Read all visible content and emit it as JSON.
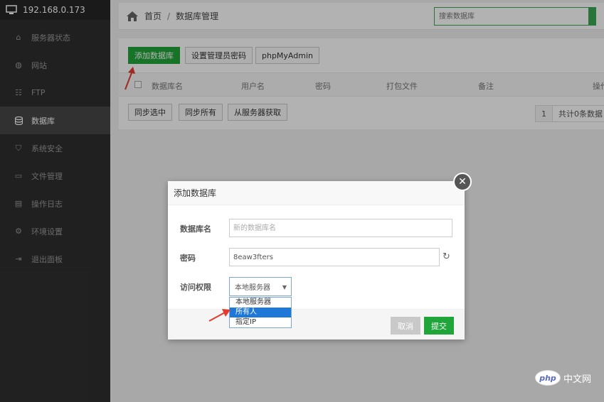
{
  "sidebar": {
    "ip": "192.168.0.173",
    "items": [
      {
        "label": "服务器状态",
        "icon": "home-icon"
      },
      {
        "label": "网站",
        "icon": "globe-icon"
      },
      {
        "label": "FTP",
        "icon": "ftp-icon"
      },
      {
        "label": "数据库",
        "icon": "database-icon",
        "active": true
      },
      {
        "label": "系统安全",
        "icon": "shield-icon"
      },
      {
        "label": "文件管理",
        "icon": "folder-icon"
      },
      {
        "label": "操作日志",
        "icon": "log-icon"
      },
      {
        "label": "环境设置",
        "icon": "gear-icon"
      },
      {
        "label": "退出面板",
        "icon": "logout-icon"
      }
    ]
  },
  "breadcrumb": {
    "home": "首页",
    "sep": "/",
    "current": "数据库管理"
  },
  "search": {
    "placeholder": "搜索数据库"
  },
  "toolbar": {
    "add_db": "添加数据库",
    "set_admin_pw": "设置管理员密码",
    "phpmyadmin": "phpMyAdmin"
  },
  "table": {
    "columns": [
      "数据库名",
      "用户名",
      "密码",
      "打包文件",
      "备注",
      "操作"
    ]
  },
  "actions": {
    "sync_selected": "同步选中",
    "sync_all": "同步所有",
    "fetch_from_server": "从服务器获取"
  },
  "pager": {
    "page": "1",
    "total": "共计0条数据"
  },
  "modal": {
    "title": "添加数据库",
    "db_name_label": "数据库名",
    "db_name_placeholder": "新的数据库名",
    "password_label": "密码",
    "password_value": "8eaw3fters",
    "access_label": "访问权限",
    "access_selected": "本地服务器",
    "access_options": [
      "本地服务器",
      "所有人",
      "指定IP"
    ],
    "access_highlighted": 1,
    "cancel": "取消",
    "submit": "提交"
  },
  "watermark": {
    "brand": "php",
    "site": "中文网"
  },
  "colors": {
    "accent_green": "#20a53a",
    "sidebar_bg": "#2f2f2f",
    "select_blue": "#1e78d7",
    "arrow_red": "#e43b2e"
  }
}
